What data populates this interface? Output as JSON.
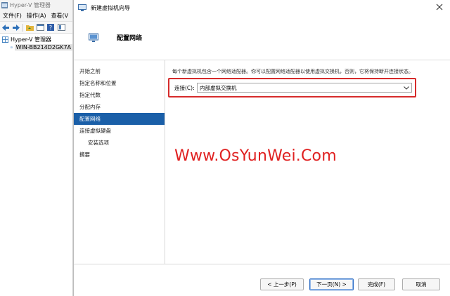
{
  "manager": {
    "title": "Hyper-V 管理器",
    "menu": [
      "文件(F)",
      "操作(A)",
      "查看(V"
    ],
    "tree": {
      "root_label": "Hyper-V 管理器",
      "server_label": "WIN-BB214D2GK7A"
    }
  },
  "wizard": {
    "title": "新建虚拟机向导",
    "header_title": "配置网络",
    "steps": [
      {
        "label": "开始之前",
        "active": false,
        "sub": false
      },
      {
        "label": "指定名称和位置",
        "active": false,
        "sub": false
      },
      {
        "label": "指定代数",
        "active": false,
        "sub": false
      },
      {
        "label": "分配内存",
        "active": false,
        "sub": false
      },
      {
        "label": "配置网络",
        "active": true,
        "sub": false
      },
      {
        "label": "连接虚拟硬盘",
        "active": false,
        "sub": false
      },
      {
        "label": "安装选项",
        "active": false,
        "sub": true
      },
      {
        "label": "摘要",
        "active": false,
        "sub": false
      }
    ],
    "description": "每个新虚拟机包含一个网络适配器。你可以配置网络适配器以使用虚拟交换机，否则，它将保持断开连接状态。",
    "connection": {
      "label": "连接(C):",
      "value": "内部虚拟交换机"
    },
    "buttons": {
      "previous": "< 上一步(P)",
      "next": "下一页(N) >",
      "finish": "完成(F)",
      "cancel": "取消"
    }
  },
  "watermark": "Www.OsYunWei.Com",
  "colors": {
    "active_step": "#1a5fa8",
    "highlight_box": "#d62b2b",
    "watermark": "#e02121"
  }
}
